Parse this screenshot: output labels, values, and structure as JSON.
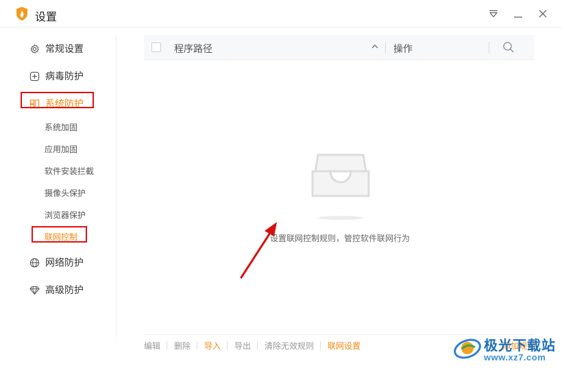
{
  "window": {
    "title": "设置",
    "accent": "#f08a13",
    "highlight_color": "#e10f0f"
  },
  "icons": {
    "app": "shield-flame-icon",
    "menu": "dropdown-menu-icon",
    "minimize": "minimize-icon",
    "close": "close-icon"
  },
  "sidebar": {
    "items": [
      {
        "label": "常规设置",
        "icon": "gear-icon"
      },
      {
        "label": "病毒防护",
        "icon": "plus-square-icon"
      },
      {
        "label": "系统防护",
        "icon": "system-grid-icon",
        "active": true
      },
      {
        "label": "网络防护",
        "icon": "globe-icon"
      },
      {
        "label": "高级防护",
        "icon": "diamond-icon"
      }
    ],
    "sub_items": [
      {
        "label": "系统加固"
      },
      {
        "label": "应用加固"
      },
      {
        "label": "软件安装拦截"
      },
      {
        "label": "摄像头保护"
      },
      {
        "label": "浏览器保护"
      },
      {
        "label": "联网控制",
        "active": true
      }
    ]
  },
  "table": {
    "header": {
      "path": "程序路径",
      "operation": "操作"
    }
  },
  "empty_state": {
    "text": "设置联网控制规则，管控软件联网行为"
  },
  "footer": {
    "edit": "编辑",
    "delete": "删除",
    "import": "导入",
    "export": "导出",
    "clear_invalid": "清除无效规则",
    "network_settings": "联网设置",
    "add_rule": "添加规则"
  },
  "watermark": {
    "brand": "极光下载站",
    "url": "www.xz7.com"
  }
}
